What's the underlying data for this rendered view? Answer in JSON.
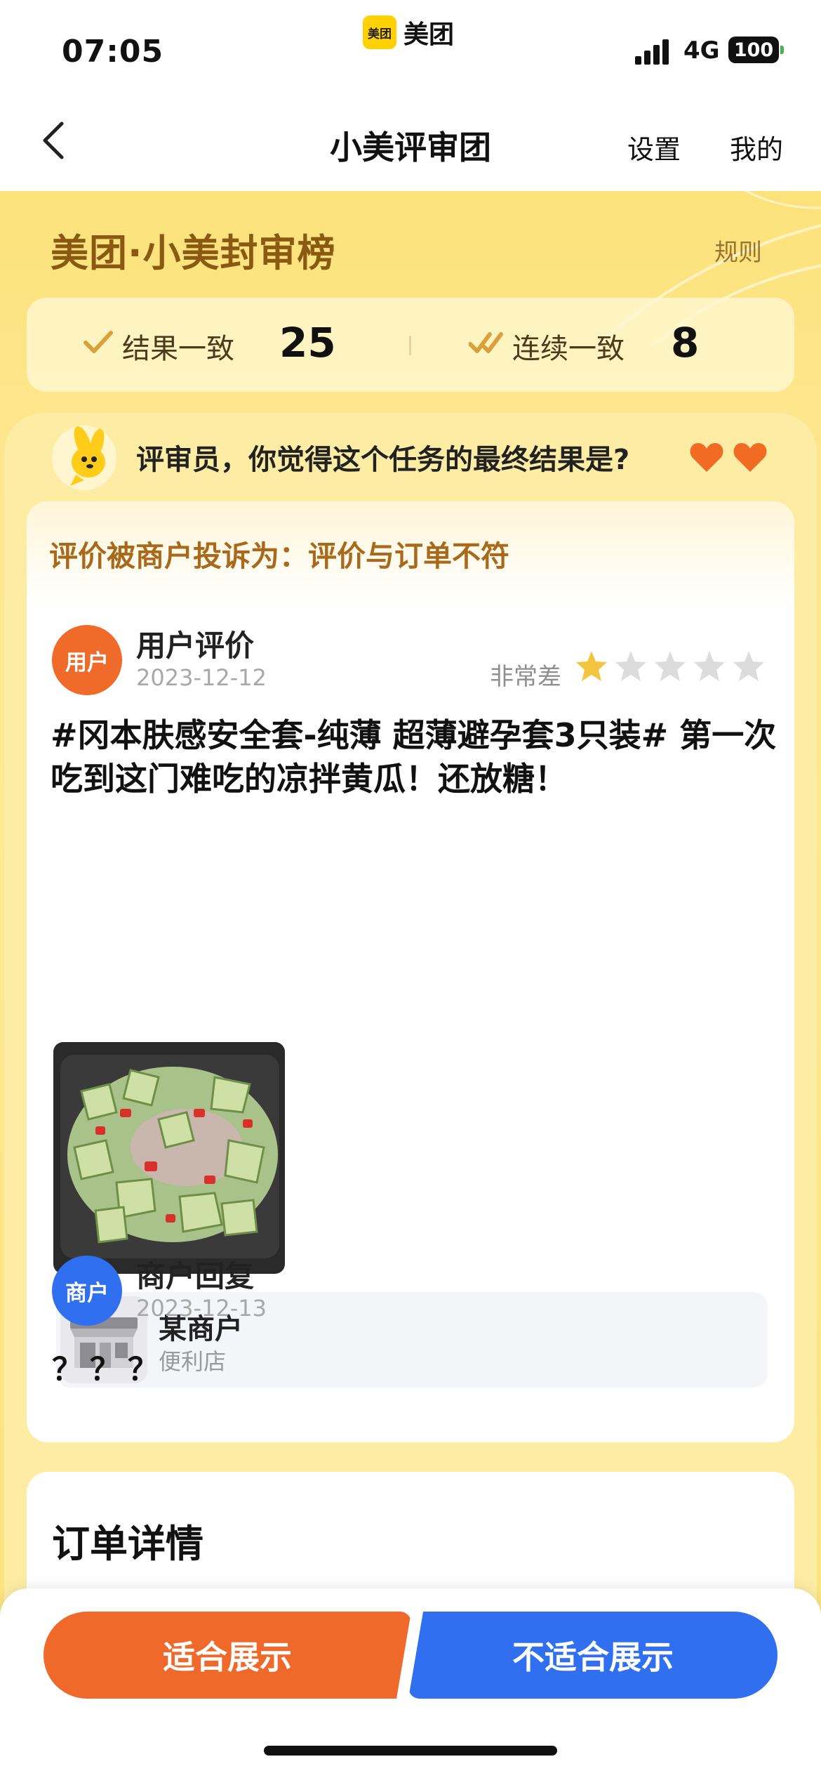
{
  "status_bar": {
    "time": "07:05",
    "app_logo_text": "美团",
    "app_name": "美团",
    "network": "4G",
    "battery": "100"
  },
  "nav": {
    "title": "小美评审团",
    "settings": "设置",
    "mine": "我的"
  },
  "board": {
    "title": "美团·小美封审榜",
    "rules": "规则",
    "stats": [
      {
        "label": "结果一致",
        "value": "25"
      },
      {
        "label": "连续一致",
        "value": "8"
      }
    ]
  },
  "question": {
    "text": "评审员，你觉得这个任务的最终结果是?",
    "hearts": 2
  },
  "review": {
    "complaint": "评价被商户投诉为：评价与订单不符",
    "user": {
      "avatar_label": "用户",
      "author": "用户评价",
      "date": "2023-12-12",
      "rating_text": "非常差",
      "rating": 1,
      "rating_max": 5
    },
    "content": "#冈本肤感安全套-纯薄 超薄避孕套3只装# 第一次吃到这门难吃的凉拌黄瓜！还放糖！",
    "merchant_card": {
      "name": "某商户",
      "type": "便利店"
    },
    "reply": {
      "avatar_label": "商户",
      "author": "商户回复",
      "date": "2023-12-13",
      "content": "？？？"
    }
  },
  "order": {
    "title": "订单详情"
  },
  "actions": {
    "suitable": "适合展示",
    "unsuitable": "不适合展示"
  },
  "colors": {
    "accent_orange": "#ef6a2a",
    "accent_blue": "#2f6ff0",
    "brand_yellow": "#ffd100",
    "star_active": "#f5c542",
    "star_inactive": "#dcdcdc"
  }
}
